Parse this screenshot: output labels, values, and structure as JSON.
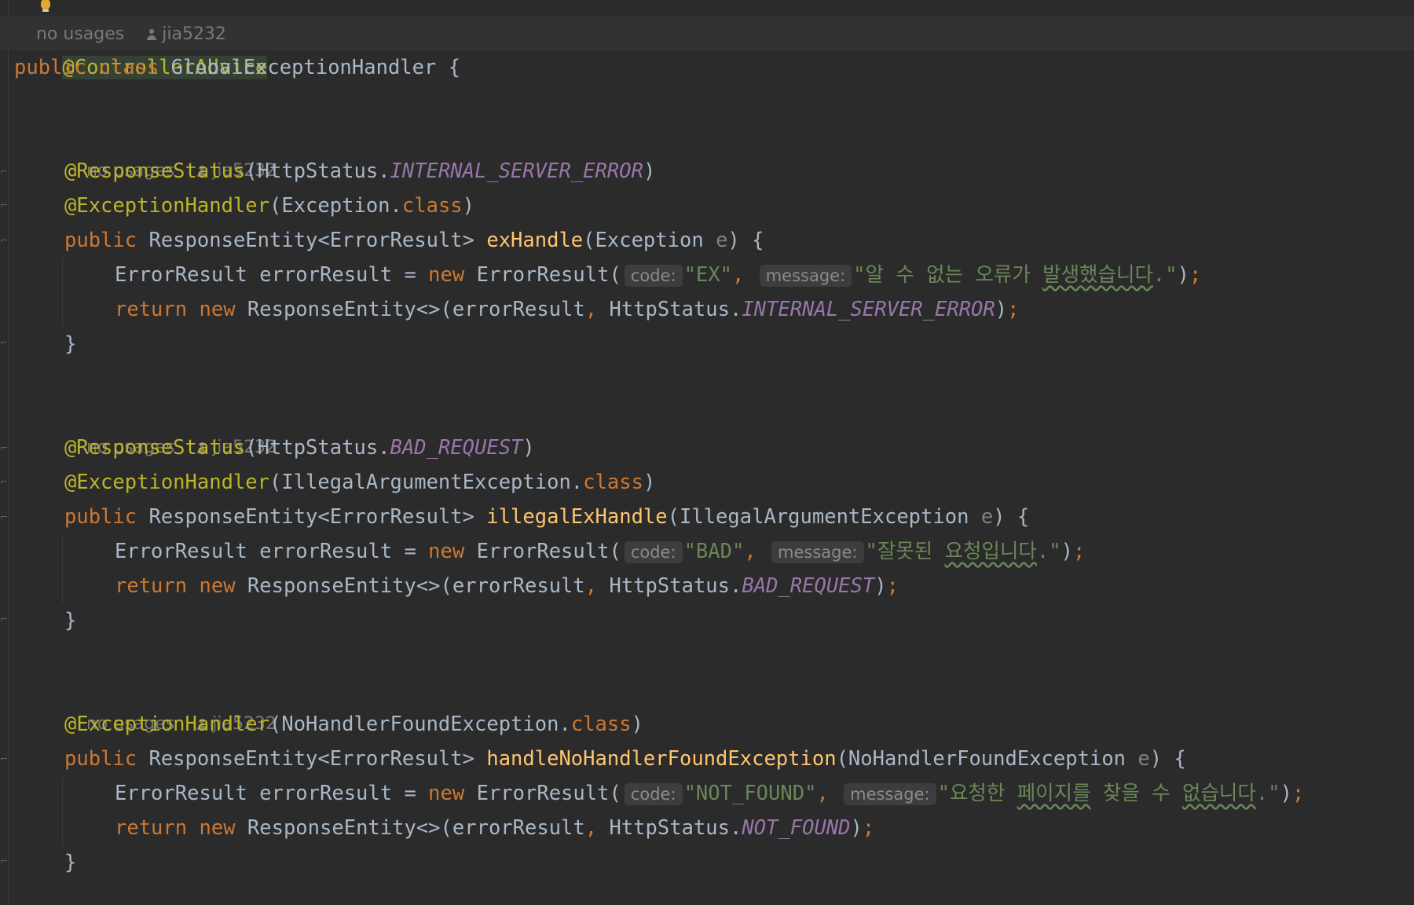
{
  "top_partial_hint": {
    "usages": "no usages",
    "author": "jia5232"
  },
  "class_annotation": "@ControllerAdvice",
  "class_decl": {
    "kw1": "public",
    "kw2": "class",
    "name": "GlobalExceptionHandler",
    "brace": "{"
  },
  "hints": [
    {
      "usages": "no usages",
      "author": "jia5232"
    },
    {
      "usages": "no usages",
      "author": "jia5232"
    },
    {
      "usages": "no usages",
      "author": "jia5232"
    }
  ],
  "m1": {
    "status_ann": "@ResponseStatus",
    "status_open": "(HttpStatus.",
    "status_const": "INTERNAL_SERVER_ERROR",
    "status_close": ")",
    "handler_ann": "@ExceptionHandler",
    "handler_arg": "(Exception.",
    "class_kw": "class",
    "handler_close": ")",
    "sig_public": "public",
    "sig_type": " ResponseEntity<ErrorResult> ",
    "sig_name": "exHandle",
    "sig_open": "(Exception ",
    "sig_param": "e",
    "sig_close": ") {",
    "body1_pre": "ErrorResult errorResult = ",
    "body1_new": "new",
    "body1_ctor": " ErrorResult(",
    "code_hint": "code:",
    "code_val": "\"EX\"",
    "comma": ",",
    "message_hint": "message:",
    "msg_plain": "\"알 수 없는 오류가 ",
    "msg_squig": "발생했습니다",
    "msg_end": ".\"",
    "body1_end": ")",
    "semi": ";",
    "ret_kw": "return",
    "ret_new": "new",
    "ret_type": " ResponseEntity<>(errorResult",
    "ret_comma": ",",
    "ret_status": " HttpStatus.",
    "ret_const": "INTERNAL_SERVER_ERROR",
    "ret_close": ")",
    "ret_semi": ";",
    "brace_close": "}"
  },
  "m2": {
    "status_ann": "@ResponseStatus",
    "status_open": "(HttpStatus.",
    "status_const": "BAD_REQUEST",
    "status_close": ")",
    "handler_ann": "@ExceptionHandler",
    "handler_arg": "(IllegalArgumentException.",
    "class_kw": "class",
    "handler_close": ")",
    "sig_public": "public",
    "sig_type": " ResponseEntity<ErrorResult> ",
    "sig_name": "illegalExHandle",
    "sig_open": "(IllegalArgumentException ",
    "sig_param": "e",
    "sig_close": ") {",
    "body1_pre": "ErrorResult errorResult = ",
    "body1_new": "new",
    "body1_ctor": " ErrorResult(",
    "code_hint": "code:",
    "code_val": "\"BAD\"",
    "comma": ",",
    "message_hint": "message:",
    "msg_plain": "\"잘못된 ",
    "msg_squig": "요청입니다",
    "msg_end": ".\"",
    "body1_end": ")",
    "semi": ";",
    "ret_kw": "return",
    "ret_new": "new",
    "ret_type": " ResponseEntity<>(errorResult",
    "ret_comma": ",",
    "ret_status": " HttpStatus.",
    "ret_const": "BAD_REQUEST",
    "ret_close": ")",
    "ret_semi": ";",
    "brace_close": "}"
  },
  "m3": {
    "handler_ann": "@ExceptionHandler",
    "handler_arg": "(NoHandlerFoundException.",
    "class_kw": "class",
    "handler_close": ")",
    "sig_public": "public",
    "sig_type": " ResponseEntity<ErrorResult> ",
    "sig_name": "handleNoHandlerFoundException",
    "sig_open": "(NoHandlerFoundException ",
    "sig_param": "e",
    "sig_close": ") {",
    "body1_pre": "ErrorResult errorResult = ",
    "body1_new": "new",
    "body1_ctor": " ErrorResult(",
    "code_hint": "code:",
    "code_val": "\"NOT_FOUND\"",
    "comma": ",",
    "message_hint": "message:",
    "msg_plain1": "\"요청한 ",
    "msg_squig1": "페이지를",
    "msg_plain2": " 찾을 수 ",
    "msg_squig2": "없습니다",
    "msg_end": ".\"",
    "body1_end": ")",
    "semi": ";",
    "ret_kw": "return",
    "ret_new": "new",
    "ret_type": " ResponseEntity<>(errorResult",
    "ret_comma": ",",
    "ret_status": " HttpStatus.",
    "ret_const": "NOT_FOUND",
    "ret_close": ")",
    "ret_semi": ";",
    "brace_close": "}"
  }
}
